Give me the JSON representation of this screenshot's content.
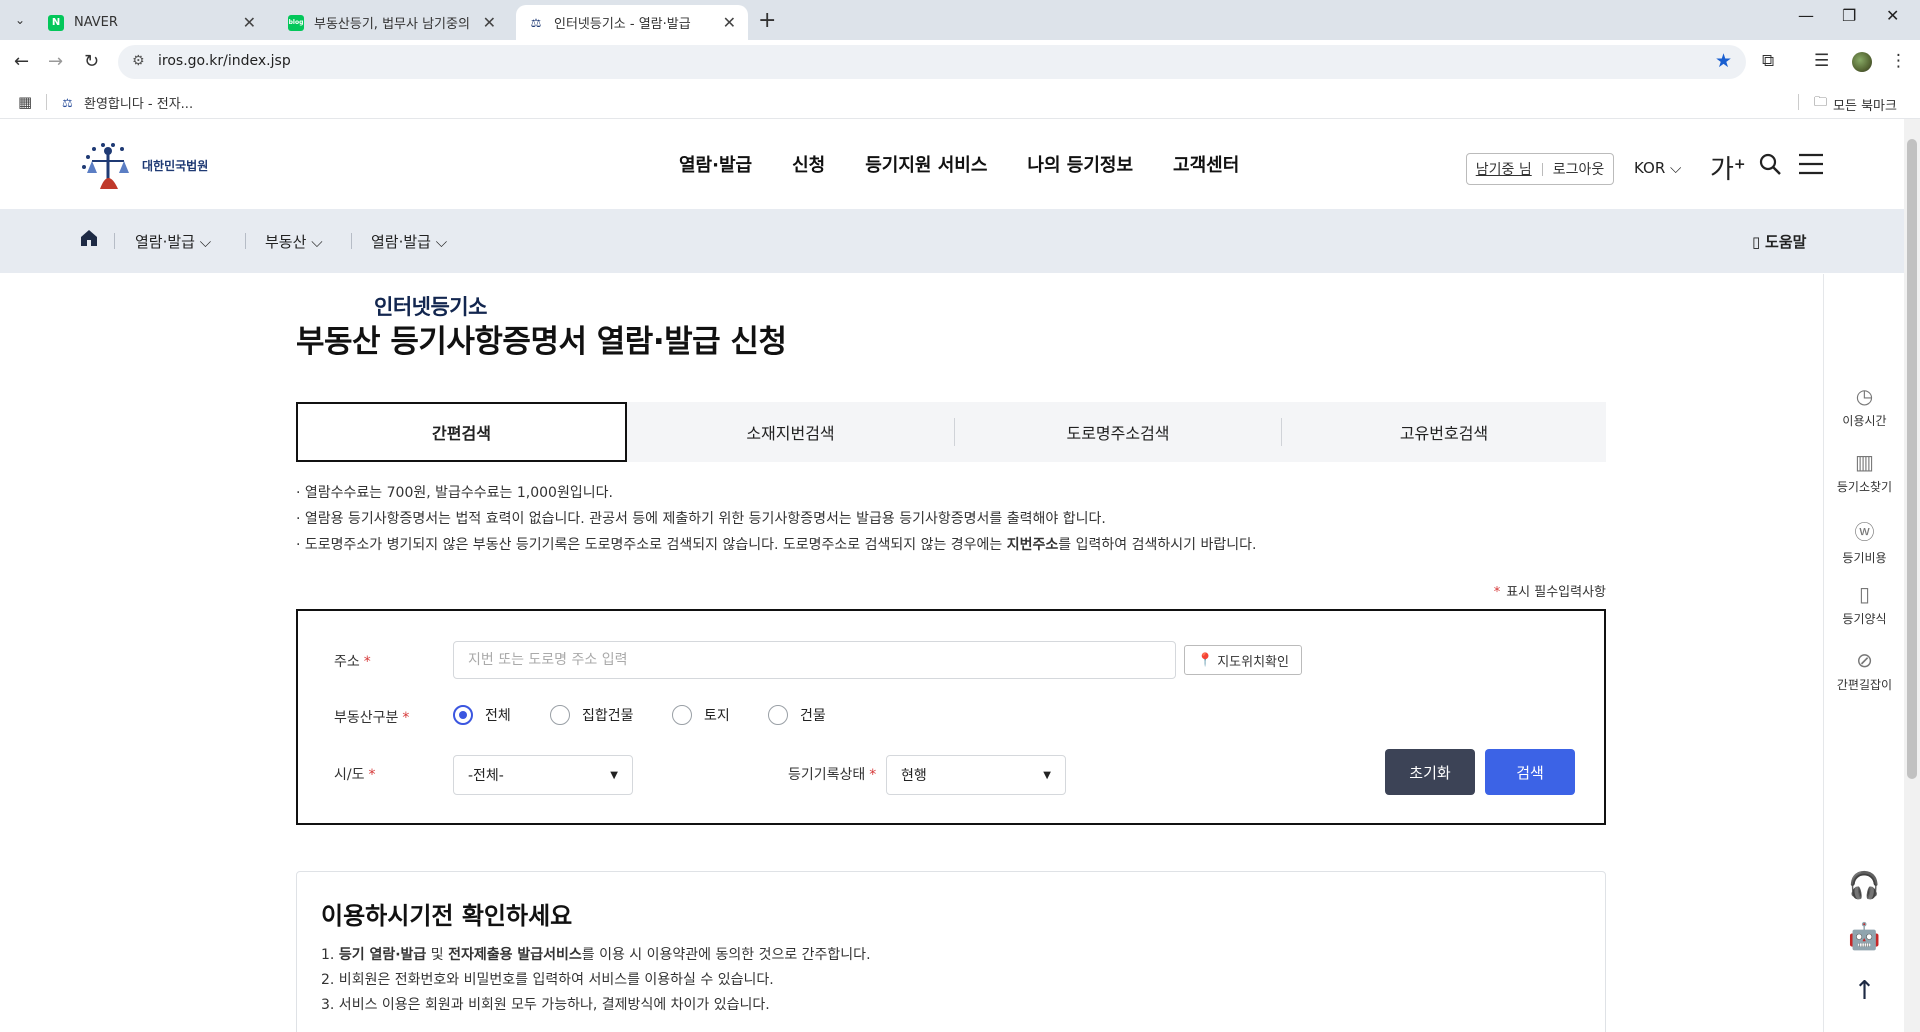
{
  "browser": {
    "tabs": [
      {
        "title": "NAVER",
        "favicon": "N",
        "color": "#03c75a"
      },
      {
        "title": "부동산등기, 법무사 남기중의 ...",
        "favicon": "blog",
        "color": "#03c75a"
      },
      {
        "title": "인터넷등기소 - 열람·발급",
        "favicon": "",
        "color": "#1f3a74"
      }
    ],
    "url": "iros.go.kr/index.jsp",
    "bookmark": "환영합니다 - 전자...",
    "all_bookmarks": "모든 북마크"
  },
  "header": {
    "logo_sub": "대한민국법원",
    "logo_main": "인터넷등기소",
    "nav": [
      "열람·발급",
      "신청",
      "등기지원 서비스",
      "나의 등기정보",
      "고객센터"
    ],
    "user_name": "남기중 님",
    "logout": "로그아웃",
    "lang": "KOR",
    "font_size_glyph": "가",
    "font_size_plus": "+"
  },
  "breadcrumb": {
    "items": [
      "열람·발급",
      "부동산",
      "열람·발급"
    ],
    "help": "도움말"
  },
  "main": {
    "title": "부동산 등기사항증명서 열람·발급 신청",
    "tabs": [
      "간편검색",
      "소재지번검색",
      "도로명주소검색",
      "고유번호검색"
    ],
    "notes": [
      "· 열람수수료는  700원, 발급수수료는  1,000원입니다.",
      "· 열람용 등기사항증명서는 법적 효력이 없습니다. 관공서 등에 제출하기 위한 등기사항증명서는 발급용 등기사항증명서를 출력해야 합니다."
    ],
    "note3_pre": "· 도로명주소가 병기되지 않은 부동산 등기기록은 도로명주소로 검색되지 않습니다. 도로명주소로 검색되지 않는 경우에는 ",
    "note3_bold": "지번주소",
    "note3_post": "를 입력하여 검색하시기 바랍니다.",
    "required_hint": "표시 필수입력사항"
  },
  "form": {
    "address_label": "주소",
    "address_placeholder": "지번 또는 도로명 주소 입력",
    "map_button": "지도위치확인",
    "type_label": "부동산구분",
    "type_options": [
      "전체",
      "집합건물",
      "토지",
      "건물"
    ],
    "type_selected": "전체",
    "sido_label": "시/도",
    "sido_value": "-전체-",
    "status_label": "등기기록상태",
    "status_value": "현행",
    "reset_button": "초기화",
    "search_button": "검색",
    "required_mark": "*"
  },
  "info": {
    "heading": "이용하시기전 확인하세요",
    "item1_num": "1. ",
    "item1_b1": "등기 열람·발급",
    "item1_m": " 및 ",
    "item1_b2": "전자제출용 발급서비스",
    "item1_post": "를 이용 시 이용약관에 동의한 것으로 간주합니다.",
    "item2": "2. 비회원은 전화번호와 비밀번호를 입력하여 서비스를 이용하실 수 있습니다.",
    "item3": "3. 서비스 이용은 회원과 비회원 모두 가능하나, 결제방식에 차이가 있습니다."
  },
  "quick_menu": [
    "이용시간",
    "등기소찾기",
    "등기비용",
    "등기양식",
    "간편길잡이"
  ]
}
